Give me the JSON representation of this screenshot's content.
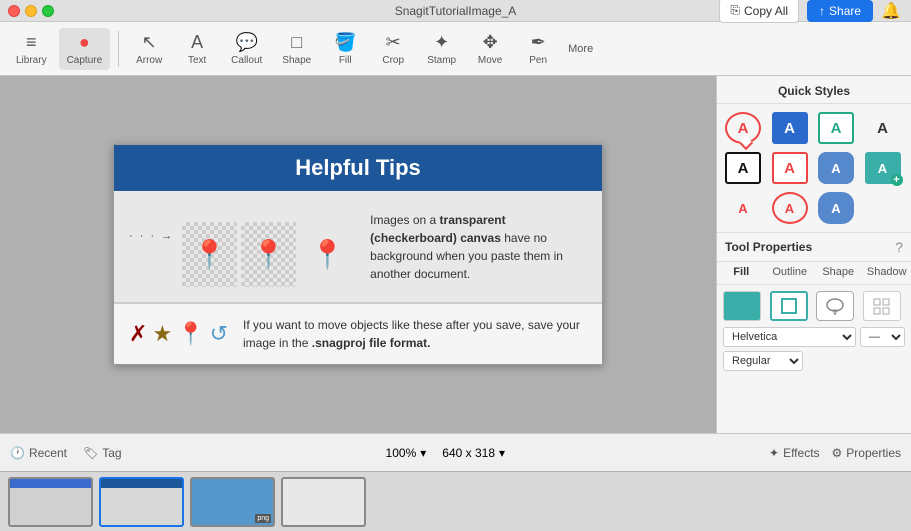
{
  "titleBar": {
    "title": "SnagitTutorialImage_A",
    "copyAllLabel": "Copy All",
    "shareLabel": "Share"
  },
  "toolbar": {
    "tools": [
      {
        "id": "arrow",
        "label": "Arrow",
        "icon": "↖"
      },
      {
        "id": "text",
        "label": "Text",
        "icon": "A"
      },
      {
        "id": "callout",
        "label": "Callout",
        "icon": "💬"
      },
      {
        "id": "shape",
        "label": "Shape",
        "icon": "□"
      },
      {
        "id": "fill",
        "label": "Fill",
        "icon": "🪣"
      },
      {
        "id": "crop",
        "label": "Crop",
        "icon": "⊠"
      },
      {
        "id": "stamp",
        "label": "Stamp",
        "icon": "✦"
      },
      {
        "id": "move",
        "label": "Move",
        "icon": "✥"
      },
      {
        "id": "pen",
        "label": "Pen",
        "icon": "✒"
      }
    ],
    "moreLabel": "More"
  },
  "canvas": {
    "title": "Helpful Tips",
    "topText": "Images on a transparent (checkerboard) canvas have no background when you paste them in another document.",
    "bottomText": "If you want to move objects like these after you save, save your image in the .snagproj file format.",
    "snagprojBold": ".snagproj file format."
  },
  "rightPanel": {
    "quickStylesTitle": "Quick Styles",
    "toolPropertiesTitle": "Tool Properties",
    "helpIcon": "?",
    "tabs": [
      {
        "id": "fill",
        "label": "Fill"
      },
      {
        "id": "outline",
        "label": "Outline"
      },
      {
        "id": "shape",
        "label": "Shape"
      },
      {
        "id": "shadow",
        "label": "Shadow"
      }
    ],
    "fontName": "Helvetica",
    "fontWeight": "Regular"
  },
  "statusBar": {
    "recentLabel": "Recent",
    "tagLabel": "Tag",
    "zoomLabel": "100%",
    "dimensionsLabel": "640 x 318",
    "effectsLabel": "Effects",
    "propertiesLabel": "Properties"
  },
  "thumbnails": [
    {
      "id": 1,
      "active": false
    },
    {
      "id": 2,
      "active": true
    },
    {
      "id": 3,
      "active": false
    },
    {
      "id": 4,
      "active": false
    }
  ]
}
